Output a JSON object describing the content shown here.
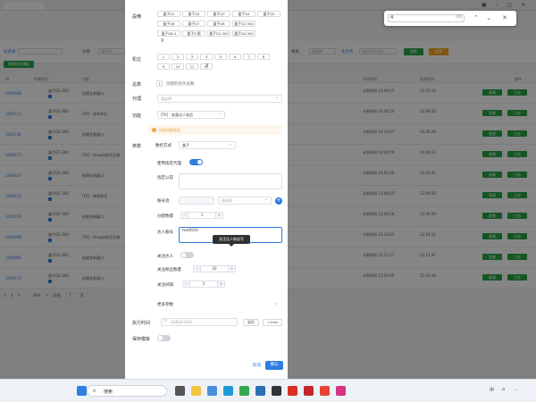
{
  "browser": {
    "find_query": "4",
    "find_count": "0/0"
  },
  "filters": {
    "task_label": "任务表",
    "source_label": "功能",
    "source_placeholder": "请选择",
    "template_label": "模板",
    "template_placeholder": "请选择",
    "main_task_label": "主任务",
    "main_task_placeholder": "请选择主任务",
    "search_label": "搜索",
    "reset_label": "重置",
    "new_btn": "新建任务模板"
  },
  "table": {
    "headers": [
      "ID",
      "所属账号",
      "功能",
      "",
      "",
      "",
      "",
      "",
      "",
      "开始时间",
      "结束时间",
      "",
      "操作"
    ],
    "rows": [
      {
        "id": "1465888",
        "acct": "盒子Q1-304",
        "func": "创建全新窗口",
        "t1": "计划时间 14:49:15",
        "t2": "14:51:16"
      },
      {
        "id": "1465711",
        "acct": "盒子Q1-304",
        "func": "[TK] - 发布作品",
        "t1": "计划时间 14:36:50",
        "t2": "14:39:32"
      },
      {
        "id": "1465746",
        "acct": "盒子Q1-304",
        "func": "创建全新窗口",
        "t1": "计划时间 14:34:07",
        "t2": "14:35:26"
      },
      {
        "id": "1465477",
        "acct": "盒子Q1-304",
        "func": "[TK] - Google账号注册",
        "t1": "计划时间 14:03:50",
        "t2": "14:06:11"
      },
      {
        "id": "1465407",
        "acct": "盒子Q1-304",
        "func": "创建全新窗口",
        "t1": "计划时间 14:02:30",
        "t2": "14:03:41"
      },
      {
        "id": "1465233",
        "acct": "盒子Q1-304",
        "func": "[TK] - 帐房账号",
        "t1": "计划时间 13:48:55",
        "t2": "13:49:50"
      },
      {
        "id": "1465226",
        "acct": "盒子Q1-304",
        "func": "创建全新窗口",
        "t1": "计划时间 13:44:18",
        "t2": "13:46:30"
      },
      {
        "id": "1465098",
        "acct": "盒子Q1-304",
        "func": "[TK] - Google账号注册",
        "t1": "计划时间 13:14:01",
        "t2": "13:14:11"
      },
      {
        "id": "1464985",
        "acct": "盒子Q1-304",
        "func": "创建全新窗口",
        "t1": "计划时间 12:11:17",
        "t2": "12:11:47"
      },
      {
        "id": "1464773",
        "acct": "盒子Q1-304",
        "func": "创建全新窗口",
        "t1": "计划时间 11:54:05",
        "t2": "11:54:49"
      }
    ],
    "act_a": "复制",
    "act_b": "日志"
  },
  "pager": {
    "p1": "1",
    "p2": "2",
    "p3": "3",
    "dots": "...",
    "last": "464",
    "next": ">",
    "goto": "前往",
    "page_input": "1",
    "page_unit": "页"
  },
  "modal": {
    "box_label": "設備",
    "boxes": [
      "盒子Q1",
      "盒子Q2",
      "盒子Q3",
      "盒子Q4",
      "盒子Q5",
      "盒子Q6",
      "盒子Q7",
      "盒子Q8",
      "盒子Q1-304",
      "盒子Q8-1",
      "盒子5-隔",
      "盒子Q1-303",
      "盒子Q4-305"
    ],
    "x": "X",
    "slot_label": "机位",
    "slots": [
      "1",
      "2",
      "3",
      "4",
      "5",
      "6",
      "7",
      "8",
      "9",
      "10",
      "11",
      "12"
    ],
    "batch_label": "总数",
    "batch_text": "创建的任务总数",
    "agent_label": "代理",
    "agent_placeholder": "请选择",
    "func_label": "功能",
    "func_value": "[TK] - 批量达人私信",
    "notice": "所选功能暂无",
    "param_label": "参数",
    "mode_label": "数控方式",
    "mode_value": "盒子",
    "proxy_label": "使用指定代理",
    "proxy_addr_label": "指定以前",
    "account_label": "账号池",
    "account_placeholder": "请选择",
    "alloc_label": "分配数量",
    "alloc_value": "1",
    "kol_label": "达人账号",
    "kol_value": "test0930",
    "follow_label": "关注达人",
    "follow_value": "",
    "follow_count_label": "关注粉丝数量",
    "follow_count_value": "20",
    "follow_interval_label": "关注间隔",
    "follow_interval_value": "2",
    "tooltip": "关注达人粉丝号",
    "more_label": "更多参数",
    "exec_label": "执行时间",
    "exec_placeholder": "选择执行时间",
    "exec_btn_a": "延时",
    "exec_btn_b": "+1min",
    "save_tpl_label": "保存模板",
    "cancel": "取消",
    "ok": "确认"
  },
  "taskbar": {
    "search": "搜索",
    "lang": "中",
    "time": "..."
  },
  "colors": {
    "primary": "#2e7de1",
    "success": "#27a544",
    "warning": "#e6a23c"
  }
}
